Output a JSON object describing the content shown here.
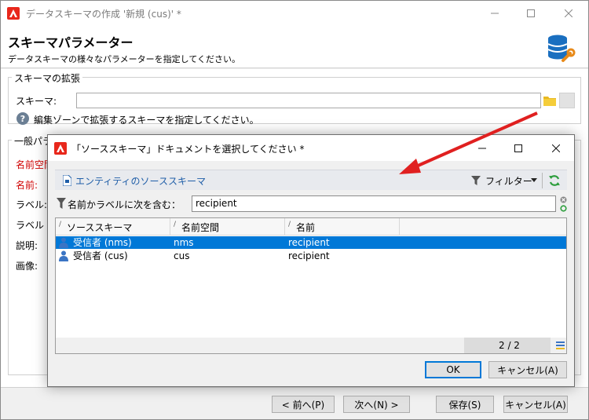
{
  "window": {
    "title": "データスキーマの作成 '新規 (cus)' *",
    "header_title": "スキーマパラメーター",
    "header_subtitle": "データスキーマの様々なパラメーターを指定してください。"
  },
  "extension_group": {
    "legend": "スキーマの拡張",
    "schema_label": "スキーマ:",
    "schema_value": "",
    "hint": "編集ゾーンで拡張するスキーマを指定してください。"
  },
  "general_group": {
    "legend": "一般パラ",
    "fields": [
      {
        "label": "名前空間",
        "required": true
      },
      {
        "label": "名前:",
        "required": true
      },
      {
        "label": "ラベル:",
        "required": false
      },
      {
        "label": "ラベル (",
        "required": false
      },
      {
        "label": "説明:",
        "required": false
      },
      {
        "label": "画像:",
        "required": false
      }
    ]
  },
  "footer": {
    "prev": "< 前へ(P)",
    "next": "次へ(N) >",
    "save": "保存(S)",
    "cancel": "キャンセル(A)"
  },
  "dialog": {
    "title": "「ソーススキーマ」ドキュメントを選択してください *",
    "entity_link": "エンティティのソーススキーマ",
    "filter_button": "フィルター",
    "filter_label": "名前かラベルに次を含む：",
    "filter_value": "recipient",
    "columns": [
      "ソーススキーマ",
      "名前空間",
      "名前"
    ],
    "rows": [
      {
        "schema": "受信者 (nms)",
        "namespace": "nms",
        "name": "recipient",
        "selected": true
      },
      {
        "schema": "受信者 (cus)",
        "namespace": "cus",
        "name": "recipient",
        "selected": false
      }
    ],
    "pager": "2 / 2",
    "ok": "OK",
    "cancel": "キャンセル(A)"
  },
  "colors": {
    "accent": "#0078d7",
    "required_label": "#d00000",
    "brand": "#e8271b",
    "arrow": "#e02020",
    "refresh": "#2e9e3e"
  }
}
